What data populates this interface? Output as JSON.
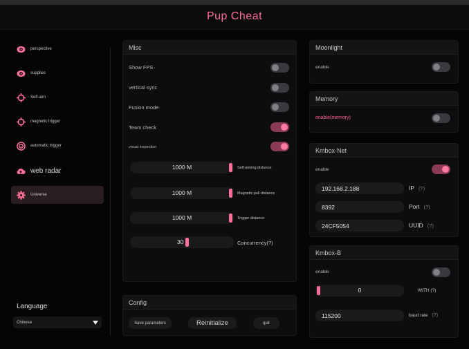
{
  "app": {
    "title": "Pup Cheat"
  },
  "sidebar": {
    "items": [
      {
        "label": "perspective",
        "icon": "eye-icon"
      },
      {
        "label": "supplies",
        "icon": "eye-icon"
      },
      {
        "label": "Self-aim",
        "icon": "crosshair-icon"
      },
      {
        "label": "magnetic trigger",
        "icon": "crosshair-icon"
      },
      {
        "label": "automatic trigger",
        "icon": "target-icon"
      },
      {
        "label": "web radar",
        "icon": "cloud-upload-icon"
      },
      {
        "label": "Universe",
        "icon": "gear-icon"
      }
    ],
    "language_label": "Language",
    "language_value": "Chinese"
  },
  "misc": {
    "title": "Misc",
    "toggles": [
      {
        "label": "Show FPS",
        "on": false
      },
      {
        "label": "vertical sync",
        "on": false
      },
      {
        "label": "Fusion mode",
        "on": false
      },
      {
        "label": "Team check",
        "on": true
      },
      {
        "label": "visual inspection",
        "on": true
      }
    ],
    "sliders": [
      {
        "value": "1000 M",
        "label": "Self-aiming distance",
        "fill": 1.0
      },
      {
        "value": "1000 M",
        "label": "Magnetic pull distance",
        "fill": 1.0
      },
      {
        "value": "1000 M",
        "label": "Trigger distance",
        "fill": 1.0
      },
      {
        "value": "30",
        "label": "Concurrency(?)",
        "fill": 0.55
      }
    ]
  },
  "config": {
    "title": "Config",
    "save_label": "Save parameters",
    "reinit_label": "Reinitialize",
    "quit_label": "quit"
  },
  "moonlight": {
    "title": "Moonlight",
    "enable_label": "enable",
    "enabled": false
  },
  "memory": {
    "title": "Memory",
    "enable_label": "enable(memory)",
    "enabled": false
  },
  "kmbox_net": {
    "title": "Kmbox-Net",
    "enable_label": "enable",
    "enabled": true,
    "ip_value": "192.168.2.188",
    "ip_label": "IP",
    "port_value": "8392",
    "port_label": "Port",
    "uuid_value": "24CF5054",
    "uuid_label": "UUID",
    "help": "(?)"
  },
  "kmbox_b": {
    "title": "Kmbox-B",
    "enable_label": "enable",
    "enabled": false,
    "com_value": "0",
    "com_fill": 0.0,
    "com_label": "WITH (?)",
    "baud_value": "115200",
    "baud_label": "baud rate",
    "help": "(?)"
  },
  "colors": {
    "accent": "#ff6f9a",
    "title": "#ff6f9a",
    "background": "#050505",
    "panel": "#0d0d0f"
  }
}
